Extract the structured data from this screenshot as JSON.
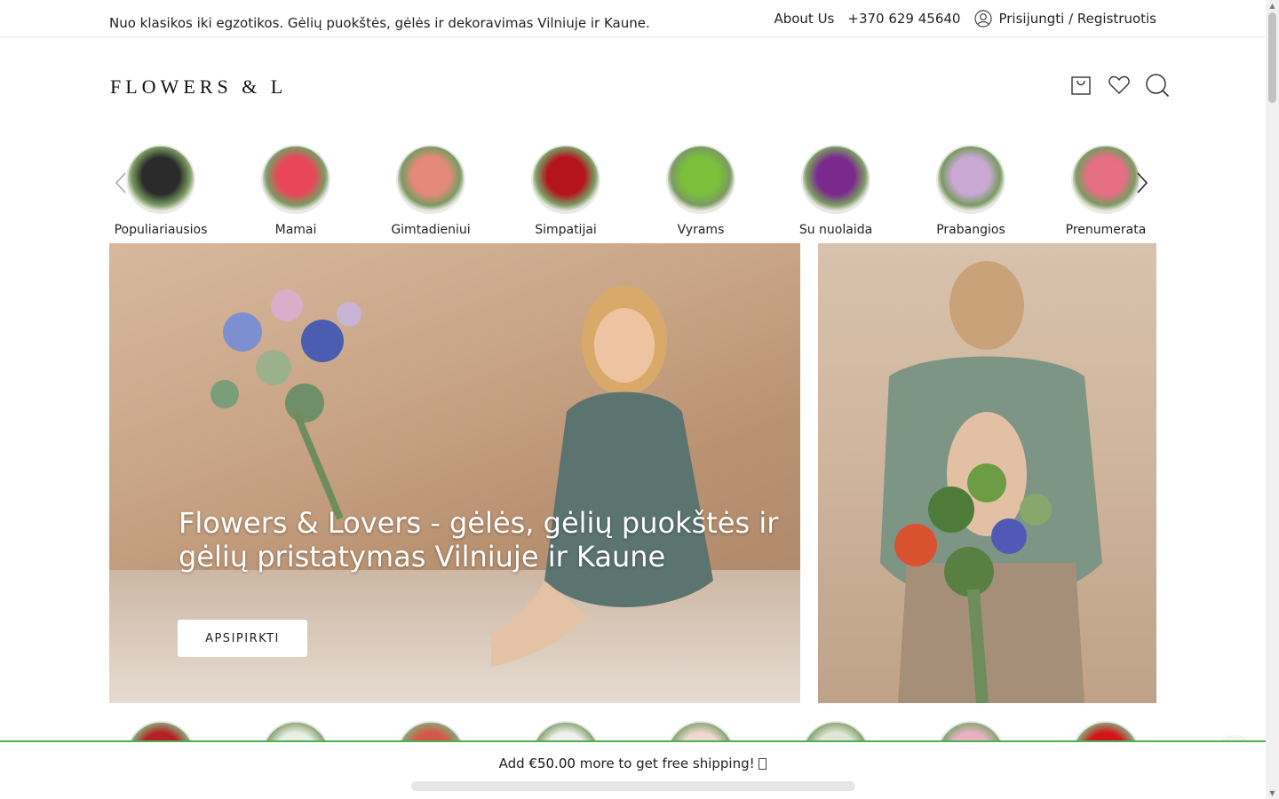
{
  "topbar": {
    "tagline": "Nuo klasikos iki egzotikos. Gėlių puokštės, gėlės ir dekoravimas Vilniuje ir Kaune.",
    "about": "About Us",
    "phone": "+370 629 45640",
    "account": "Prisijungti / Registruotis"
  },
  "header": {
    "logo_text": "FLOWERS & LOVERS",
    "icons": [
      "cart-icon",
      "heart-icon",
      "search-icon"
    ]
  },
  "categories": [
    {
      "label": "Populiariausios",
      "color": "#2b2b2b"
    },
    {
      "label": "Mamai",
      "color": "#e8475a"
    },
    {
      "label": "Gimtadieniui",
      "color": "#e58a7a"
    },
    {
      "label": "Simpatijai",
      "color": "#b3141d"
    },
    {
      "label": "Vyrams",
      "color": "#7bbf3a"
    },
    {
      "label": "Su nuolaida",
      "color": "#7a2a8c"
    },
    {
      "label": "Prabangios",
      "color": "#c9a9d4"
    },
    {
      "label": "Prenumerata",
      "color": "#e66e85"
    }
  ],
  "hero": {
    "title": "Flowers & Lovers - gėlės, gėlių puokštės ir gėlių pristatymas Vilniuje ir Kaune",
    "button": "APSIPIRKTI"
  },
  "products_colors": [
    "#b52025",
    "#e9eee2",
    "#d6574a",
    "#f0efed",
    "#efd8cf",
    "#dfe6d6",
    "#e8b2c3",
    "#d4141b"
  ],
  "shipping": {
    "prefix": "Add",
    "amount": "€50.00",
    "suffix": "more to get free shipping! ",
    "progress_percent": 0,
    "accent": "#4caf50"
  }
}
